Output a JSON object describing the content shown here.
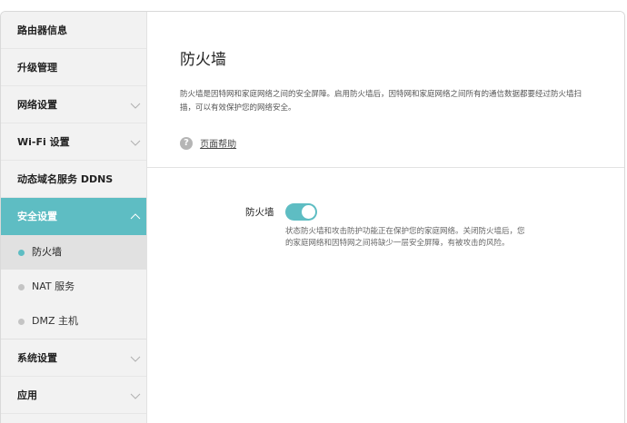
{
  "sidebar": {
    "items": [
      {
        "label": "路由器信息"
      },
      {
        "label": "升级管理"
      },
      {
        "label": "网络设置"
      },
      {
        "label": "Wi-Fi 设置"
      },
      {
        "label": "动态域名服务 DDNS"
      },
      {
        "label": "安全设置"
      },
      {
        "label": "系统设置"
      },
      {
        "label": "应用"
      }
    ],
    "security_sub": [
      {
        "label": "防火墙"
      },
      {
        "label": "NAT 服务"
      },
      {
        "label": "DMZ 主机"
      }
    ]
  },
  "main": {
    "title": "防火墙",
    "description": "防火墙是因特网和家庭网络之间的安全屏障。启用防火墙后，因特网和家庭网络之间所有的通信数据都要经过防火墙扫描，可以有效保护您的网络安全。",
    "help": {
      "icon": "question-icon",
      "label": "页面帮助"
    },
    "firewall": {
      "label": "防火墙",
      "enabled": true,
      "description": "状态防火墙和攻击防护功能正在保护您的家庭网络。关闭防火墙后，您的家庭网络和因特网之间将缺少一层安全屏障，有被攻击的风险。"
    }
  },
  "colors": {
    "accent": "#5ebdc3",
    "sidebar_bg": "#f2f2f2"
  }
}
